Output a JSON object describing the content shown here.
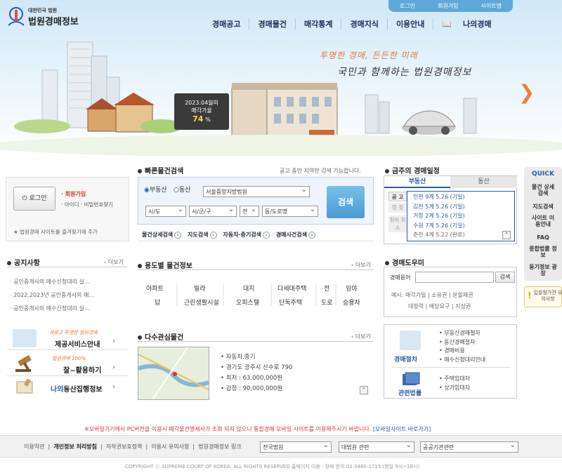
{
  "header": {
    "logo_top": "대한민국 법원",
    "logo_main": "법원경매정보",
    "top_links": [
      "로그인",
      "회원가입",
      "사이트맵"
    ],
    "gnb": [
      "경매공고",
      "경매물건",
      "매각통계",
      "경매지식",
      "이용안내",
      "나의경매"
    ],
    "slogan_line1": "투명한 경매, 든든한 미래",
    "slogan_line2": "국민과 함께하는 법원경매정보",
    "sign_line1": "2023.04월의",
    "sign_line2": "매각가율",
    "sign_pct": "74",
    "sign_pct_unit": "%"
  },
  "login": {
    "button": "로그인",
    "join": "· 회원가입",
    "find": "· 아이디 · 비밀번호찾기",
    "favorite": "법원경매 사이트를 즐겨찾기에 추가"
  },
  "notice": {
    "title": "공지사항",
    "more": "더보기",
    "items": [
      "공인중개사의 매수신청대리 실...",
      "2022,2023년 공인중개사의 매...",
      "공인중개사의 매수신청대리 실..."
    ]
  },
  "banners": [
    {
      "small": "새로고 투명한 법원경매",
      "big": "제공서비스안내"
    },
    {
      "small": "법원경매 100%",
      "big": "잘~활용하기"
    },
    {
      "small": "",
      "big_prefix": "나의",
      "big": "동산집행정보"
    }
  ],
  "quick_search": {
    "title": "빠른물건검색",
    "note": "공고 중인 지역만 검색 가능합니다.",
    "radio_real": "부동산",
    "radio_movable": "동산",
    "court": "서울중앙지방법원",
    "sido": "시/도",
    "sigungu": "시/군/구",
    "eupmyeon": "전",
    "dong": "동/도로명",
    "search_button": "검색",
    "tabs": [
      "물건상세검색",
      "지도검색",
      "자동차·중기검색",
      "경매사건검색"
    ]
  },
  "usage": {
    "title": "용도별 물건정보",
    "more": "더보기",
    "row1": [
      "아파트",
      "빌라",
      "대지",
      "다세대주택",
      "전",
      "임야"
    ],
    "row2": [
      "답",
      "근린생활시설",
      "오피스텔",
      "단독주택",
      "도로",
      "승용차"
    ]
  },
  "interest": {
    "title": "다수관심물건",
    "more": "더보기",
    "items": [
      "자동차,중기",
      "경기도 광주시 산수로 790",
      "최저 : 63,000,000원",
      "감정 : 90,000,000원"
    ]
  },
  "schedule": {
    "title": "금주의 경매일정",
    "tab_real": "부동산",
    "tab_movable": "동산",
    "side_labels": [
      "공 고",
      "정 정",
      "취하 취소"
    ],
    "entries": [
      {
        "text": "인천 9계 5.26 (기일)"
      },
      {
        "text": "김천 5계 5.26 (기일)"
      },
      {
        "text": "거창 2계 5.26 (기일)"
      },
      {
        "text": "수원 7계 5.26 (기일)"
      },
      {
        "text": "춘천 4계 5.22 (완료)"
      }
    ]
  },
  "help": {
    "title": "경매도우미",
    "label": "경매용어",
    "search_button": "검색",
    "example_label": "예시:",
    "examples1": [
      "매각기일",
      "소유권",
      "분할채권"
    ],
    "examples2": [
      "대항력",
      "배당요구",
      "지상권"
    ]
  },
  "procedure": {
    "label1": "경매절차",
    "items1": [
      "부동산경매절차",
      "동산경매절차",
      "경매비용",
      "매수신청대리안내"
    ],
    "label2": "관련법률",
    "items2": [
      "주택임대차",
      "상가임대차"
    ]
  },
  "quick": {
    "title": "QUICK",
    "items": [
      "물건 상세검색",
      "지도검색",
      "사이트 이용안내",
      "FAQ",
      "종합법률 정보",
      "동기정보 광장"
    ],
    "notice": "입찰참가전 유의사항"
  },
  "mobile_notice": {
    "text": "※모바일기기에서 PC버전을 이용시 매각물건명세서가 조회 되지 않으니 통합경매 모바일 사이트를 이용해주시기 바랍니다.",
    "link": "[모바일사이트 바로가기]"
  },
  "footer": {
    "links": [
      "이용약관",
      "개인정보 처리방침",
      "저작권보호정책",
      "이용시 유의사항",
      "법원경매정보 링크"
    ],
    "select1": "전국법원",
    "select2": "대법원 관련",
    "select3": "공공기관관련",
    "copyright": "COPYRIGHT ⓒ SUPREME COURT OF KOREA. ALL RIGHTS RESERVED  홈페이지 이용 · 장애 문의 02-3480-1715 (평일 9시~18시)"
  },
  "colors": {
    "brand": "#1a2c5a",
    "accent": "#e8823c",
    "link": "#2a5ba8",
    "red": "#d33"
  }
}
